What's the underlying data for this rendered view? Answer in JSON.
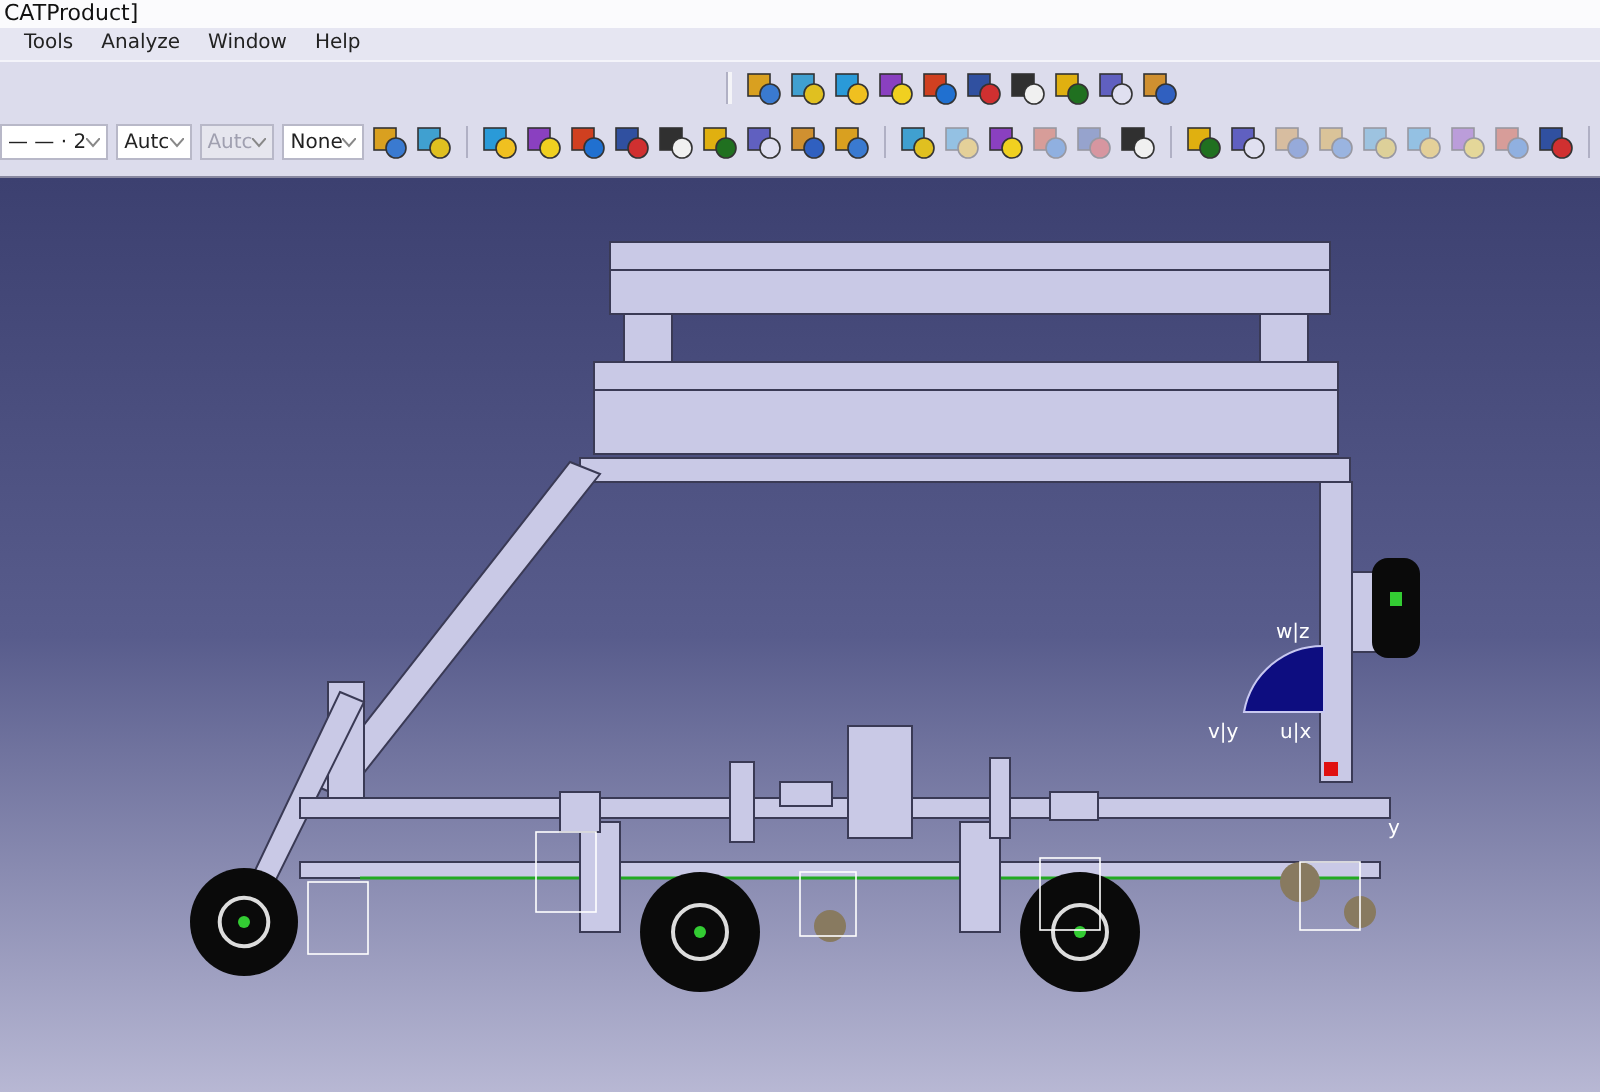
{
  "window": {
    "title": "CATProduct]"
  },
  "menu": [
    "Tools",
    "Analyze",
    "Window",
    "Help"
  ],
  "properties_toolbar": [
    {
      "kind": "combo",
      "value": "— — · 2",
      "disabled": false
    },
    {
      "kind": "combo",
      "value": "Autc",
      "disabled": false
    },
    {
      "kind": "combo",
      "value": "Autc",
      "disabled": true
    },
    {
      "kind": "combo-wide",
      "value": "None",
      "disabled": false
    }
  ],
  "viewport": {
    "axis_labels": [
      {
        "text": "w|z"
      },
      {
        "text": "v|y"
      },
      {
        "text": "u|x"
      }
    ],
    "part_axis_label": "y"
  }
}
